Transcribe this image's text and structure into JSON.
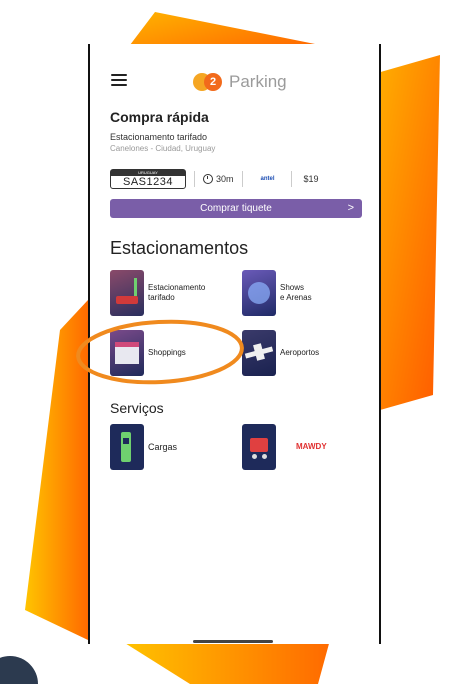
{
  "header": {
    "app_name": "Parking",
    "logo_glyph": "2",
    "menu_icon": "hamburger-menu-icon"
  },
  "quick_purchase": {
    "title": "Compra rápida",
    "service": "Estacionamento tarifado",
    "location": "Canelones - Ciudad, Uruguay",
    "plate_country": "URUGUAY",
    "plate_number": "SAS1234",
    "duration": "30m",
    "operator": "antel",
    "price": "$19",
    "button_label": "Comprar tiquete",
    "button_arrow": ">"
  },
  "parking": {
    "title": "Estacionamentos",
    "items": [
      {
        "line1": "Estacionamento",
        "line2": "tarifado"
      },
      {
        "line1": "Shows",
        "line2": "e Arenas"
      },
      {
        "line1": "Shoppings",
        "line2": ""
      },
      {
        "line1": "Aeroportos",
        "line2": ""
      }
    ]
  },
  "services": {
    "title": "Serviços",
    "items": [
      {
        "label": "Cargas"
      },
      {
        "label": "MAWDY"
      }
    ]
  },
  "colors": {
    "accent_orange": "#f26a1b",
    "accent_yellow": "#f5a623",
    "button_purple": "#7a5ea8",
    "tile_navy": "#1e2a5a"
  }
}
